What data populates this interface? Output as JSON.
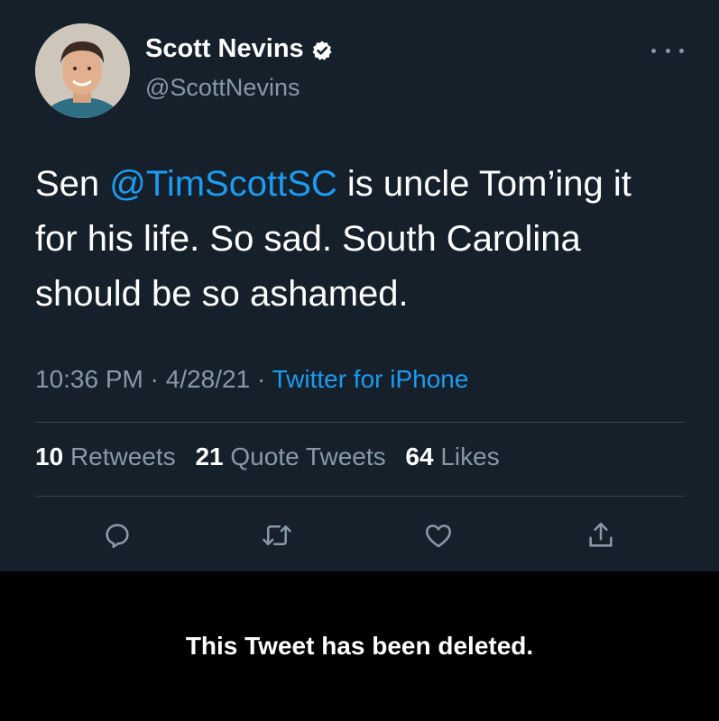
{
  "tweet": {
    "author_name": "Scott Nevins",
    "author_handle": "@ScottNevins",
    "verified_icon": "verified-badge-icon",
    "more_icon": "more-dots-icon",
    "text_prefix": "Sen ",
    "mention": "@TimScottSC",
    "text_line1_rest": " is uncle Tom’ing it",
    "text_line2": "for his life. So sad. South Carolina",
    "text_line3": "should be so ashamed.",
    "time": "10:36 PM",
    "date": "4/28/21",
    "source": "Twitter for iPhone",
    "stats": {
      "retweets_count": "10",
      "retweets_label": "Retweets",
      "quotes_count": "21",
      "quotes_label": "Quote Tweets",
      "likes_count": "64",
      "likes_label": "Likes"
    },
    "actions": [
      "reply-icon",
      "retweet-icon",
      "like-icon",
      "share-icon"
    ]
  },
  "notice": {
    "deleted_text": "This Tweet has been deleted."
  },
  "colors": {
    "background": "#15202b",
    "accent": "#1d9bf0",
    "secondary_text": "#8899a6",
    "divider": "#38444d",
    "notice_background": "#000000"
  }
}
